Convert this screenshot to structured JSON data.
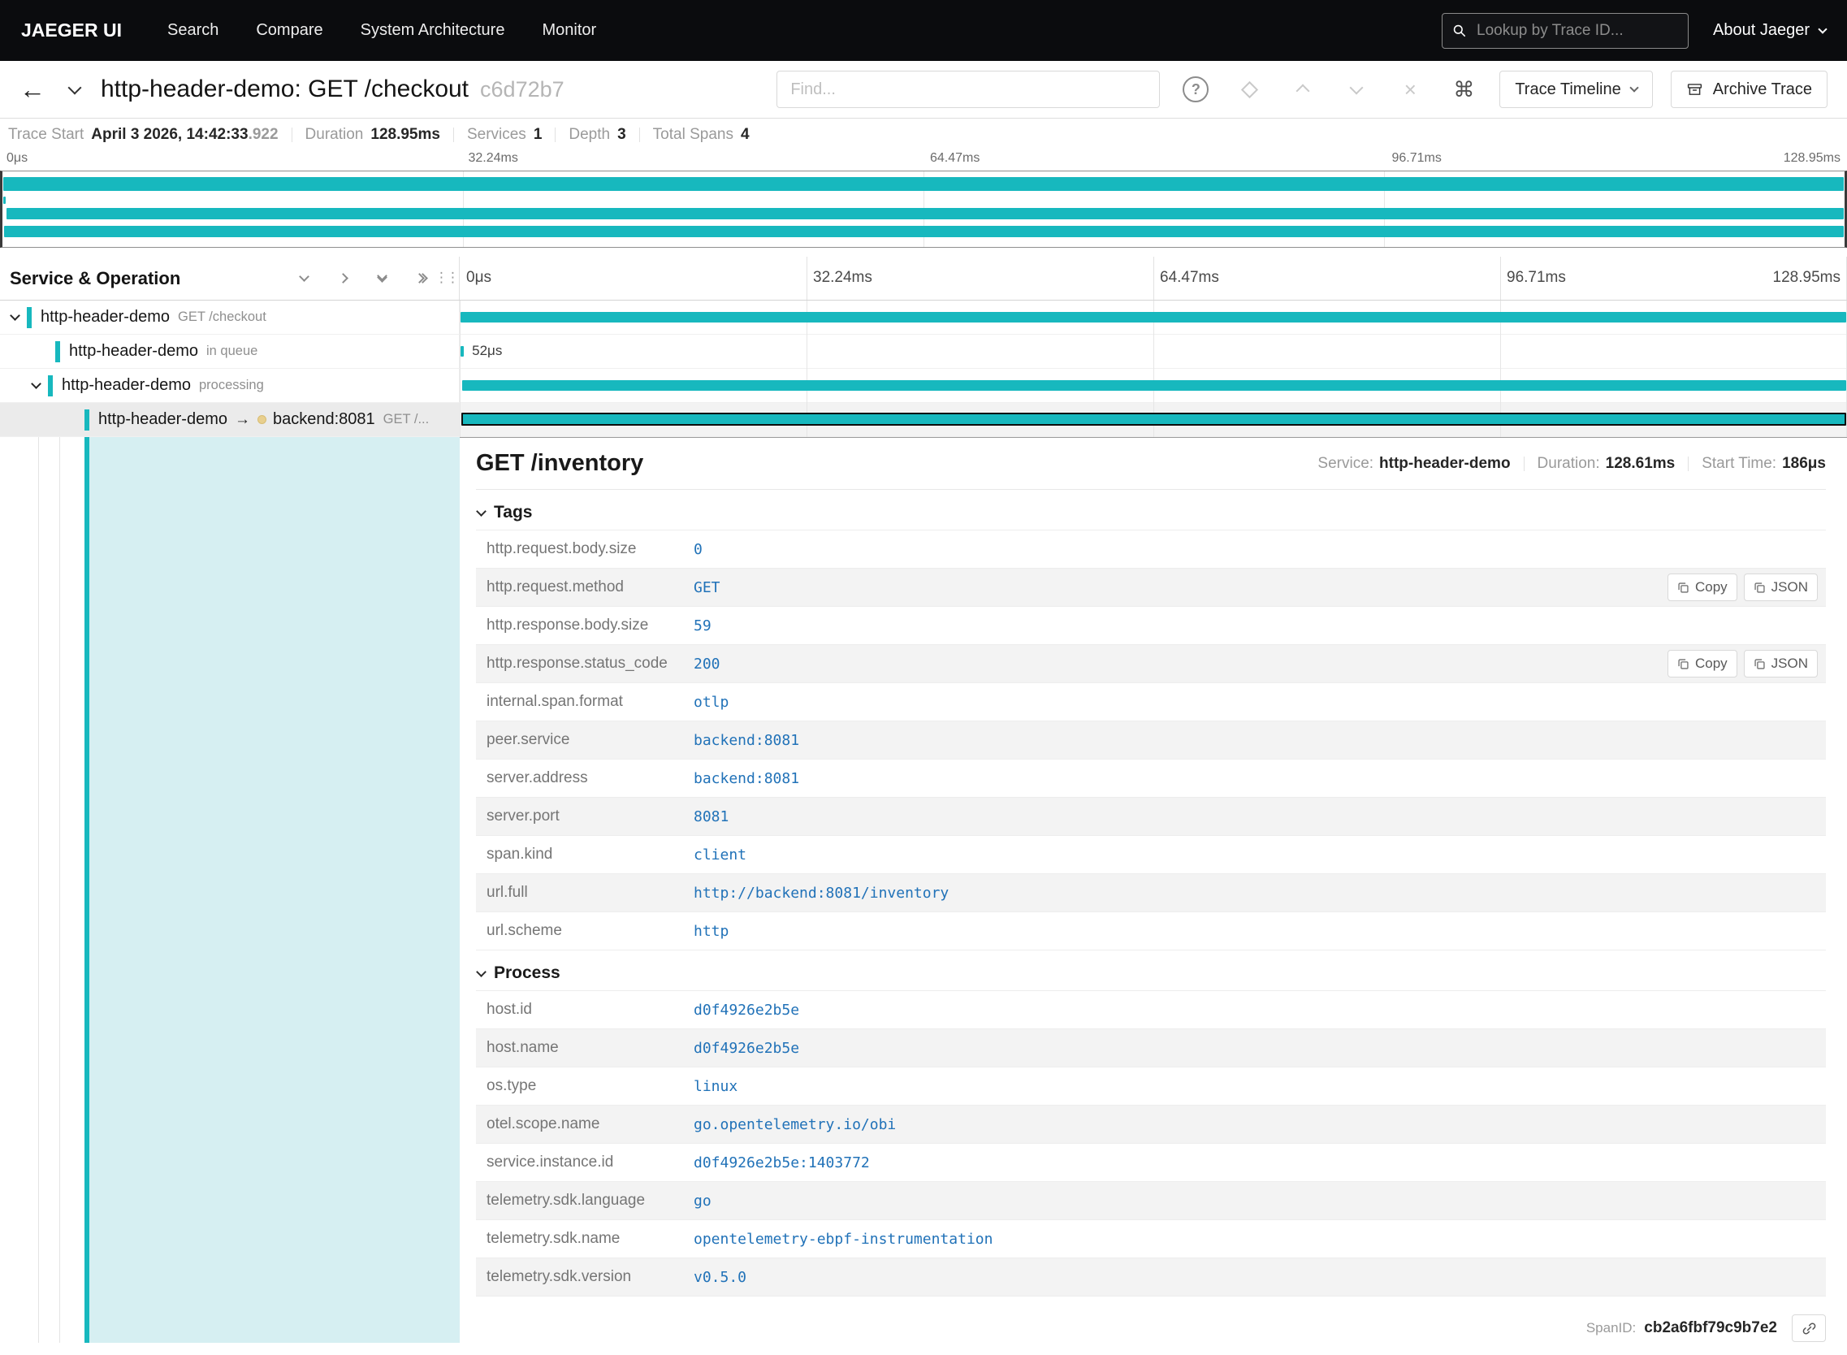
{
  "icons": {
    "command": "⌘",
    "clear": "×",
    "help": "?",
    "grip": "⋮⋮",
    "arrow_right": "→",
    "back_arrow": "←"
  },
  "colors": {
    "accent_teal": "#17b8be",
    "value_text_blue": "#2172b8",
    "selected_row_gray": "#f3f3f3",
    "detail_highlight_teal": "#d6eff2",
    "peer_dot_yellow": "#e8cf8e",
    "topnav_black": "#0b0c0e"
  },
  "topnav": {
    "brand": "JAEGER UI",
    "items": [
      "Search",
      "Compare",
      "System Architecture",
      "Monitor"
    ],
    "search_placeholder": "Lookup by Trace ID...",
    "about": "About Jaeger"
  },
  "header": {
    "title": "http-header-demo: GET /checkout",
    "trace_id": "c6d72b7",
    "find_placeholder": "Find...",
    "view_label": "Trace Timeline",
    "archive_label": "Archive Trace"
  },
  "summary": {
    "items": [
      {
        "label": "Trace Start",
        "value": "April 3 2026, 14:42:33",
        "value_light": ".922"
      },
      {
        "label": "Duration",
        "value": "128.95ms"
      },
      {
        "label": "Services",
        "value": "1"
      },
      {
        "label": "Depth",
        "value": "3"
      },
      {
        "label": "Total Spans",
        "value": "4"
      }
    ]
  },
  "timeline": {
    "left_header": "Service & Operation",
    "ticks": [
      "0μs",
      "32.24ms",
      "64.47ms",
      "96.71ms",
      "128.95ms"
    ],
    "rows": [
      {
        "service": "http-header-demo",
        "operation": "GET /checkout",
        "expandable": true,
        "selected": false,
        "start_pct": 0.05,
        "width_pct": 99.9,
        "duration_label": ""
      },
      {
        "service": "http-header-demo",
        "operation": "in queue",
        "expandable": false,
        "selected": false,
        "start_pct": 0.05,
        "width_pct": 0.04,
        "duration_label": "52μs"
      },
      {
        "service": "http-header-demo",
        "operation": "processing",
        "expandable": true,
        "selected": false,
        "start_pct": 0.2,
        "width_pct": 99.75,
        "duration_label": ""
      },
      {
        "service": "http-header-demo",
        "operation": "GET /...",
        "peer": "backend:8081",
        "arrow": true,
        "expandable": false,
        "selected": true,
        "start_pct": 0.1,
        "width_pct": 99.85,
        "duration_label": ""
      }
    ]
  },
  "detail": {
    "title": "GET /inventory",
    "meta": [
      {
        "label": "Service:",
        "value": "http-header-demo"
      },
      {
        "label": "Duration:",
        "value": "128.61ms"
      },
      {
        "label": "Start Time:",
        "value": "186μs"
      }
    ],
    "tags_header": "Tags",
    "tags": [
      {
        "key": "http.request.body.size",
        "value": "0",
        "actions": false
      },
      {
        "key": "http.request.method",
        "value": "GET",
        "actions": true
      },
      {
        "key": "http.response.body.size",
        "value": "59",
        "actions": false
      },
      {
        "key": "http.response.status_code",
        "value": "200",
        "actions": true
      },
      {
        "key": "internal.span.format",
        "value": "otlp",
        "actions": false
      },
      {
        "key": "peer.service",
        "value": "backend:8081",
        "actions": false
      },
      {
        "key": "server.address",
        "value": "backend:8081",
        "actions": false
      },
      {
        "key": "server.port",
        "value": "8081",
        "actions": false
      },
      {
        "key": "span.kind",
        "value": "client",
        "actions": false
      },
      {
        "key": "url.full",
        "value": "http://backend:8081/inventory",
        "actions": false
      },
      {
        "key": "url.scheme",
        "value": "http",
        "actions": false
      }
    ],
    "process_header": "Process",
    "process": [
      {
        "key": "host.id",
        "value": "d0f4926e2b5e"
      },
      {
        "key": "host.name",
        "value": "d0f4926e2b5e"
      },
      {
        "key": "os.type",
        "value": "linux"
      },
      {
        "key": "otel.scope.name",
        "value": "go.opentelemetry.io/obi"
      },
      {
        "key": "service.instance.id",
        "value": "d0f4926e2b5e:1403772"
      },
      {
        "key": "telemetry.sdk.language",
        "value": "go"
      },
      {
        "key": "telemetry.sdk.name",
        "value": "opentelemetry-ebpf-instrumentation"
      },
      {
        "key": "telemetry.sdk.version",
        "value": "v0.5.0"
      }
    ],
    "copy_label": "Copy",
    "json_label": "JSON",
    "spanid_label": "SpanID:",
    "spanid_value": "cb2a6fbf79c9b7e2"
  }
}
